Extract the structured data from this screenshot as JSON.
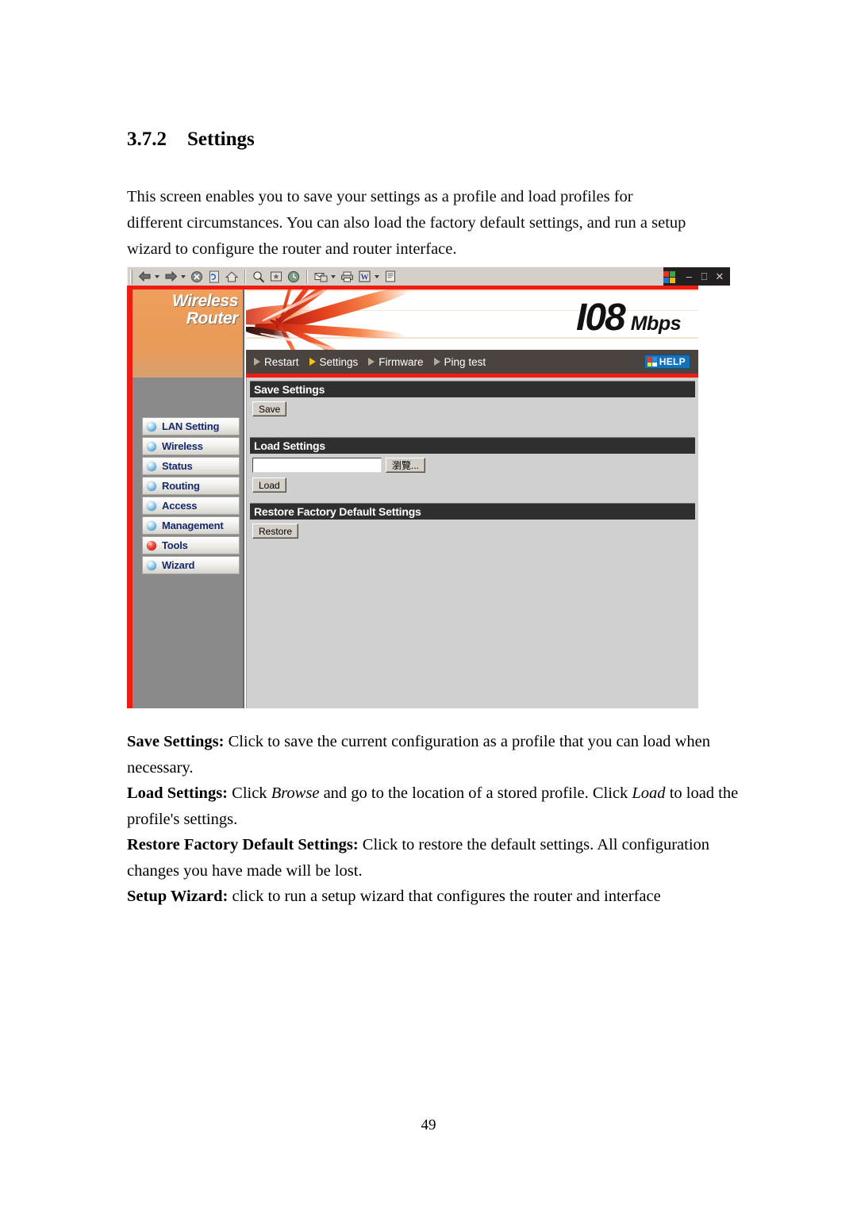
{
  "document": {
    "heading_number": "3.7.2",
    "heading_title": "Settings",
    "intro_line1": "This screen enables you to save your settings as a profile and load profiles for",
    "intro_line2": "different circumstances. You can also load the factory default settings, and run a setup",
    "intro_line3": "wizard to configure the router and router interface.",
    "page_number": "49"
  },
  "descriptions": [
    {
      "term": "Save Settings:",
      "text": " Click to save the current configuration as a profile that you can load when necessary."
    },
    {
      "term": "Load Settings:",
      "text_a": " Click ",
      "em_a": "Browse",
      "text_b": " and go to the location of a stored profile. Click ",
      "em_b": "Load",
      "text_c": " to load the profile's settings."
    },
    {
      "term": "Restore Factory Default Settings:",
      "text": " Click to restore the default settings. All configuration changes you have made will be lost."
    },
    {
      "term": "Setup Wizard:",
      "text": " click to run a setup wizard that configures the router and interface"
    }
  ],
  "browser": {
    "toolbar": {
      "icons": [
        "back-icon",
        "back-dropdown-icon",
        "forward-icon",
        "forward-dropdown-icon",
        "stop-icon",
        "refresh-icon",
        "home-icon",
        "search-icon",
        "favorites-icon",
        "history-icon",
        "mail-icon",
        "mail-dropdown-icon",
        "print-icon",
        "edit-icon",
        "edit-dropdown-icon",
        "discuss-icon"
      ]
    },
    "window_controls": {
      "minimize": "–",
      "restore": "❐",
      "close": "✕"
    }
  },
  "router_ui": {
    "logo_line1": "Wireless",
    "logo_line2": "Router",
    "banner_number": "I08",
    "banner_unit": "Mbps",
    "nav": [
      {
        "label": "Restart",
        "active": false
      },
      {
        "label": "Settings",
        "active": true
      },
      {
        "label": "Firmware",
        "active": false
      },
      {
        "label": "Ping test",
        "active": false
      }
    ],
    "help_label": "HELP",
    "sidebar": [
      {
        "label": "LAN Setting",
        "active": false
      },
      {
        "label": "Wireless",
        "active": false
      },
      {
        "label": "Status",
        "active": false
      },
      {
        "label": "Routing",
        "active": false
      },
      {
        "label": "Access",
        "active": false
      },
      {
        "label": "Management",
        "active": false
      },
      {
        "label": "Tools",
        "active": true
      },
      {
        "label": "Wizard",
        "active": false
      }
    ],
    "sections": {
      "save": {
        "header": "Save Settings",
        "button": "Save"
      },
      "load": {
        "header": "Load Settings",
        "file_value": "",
        "browse_button": "瀏覽...",
        "load_button": "Load"
      },
      "restore": {
        "header": "Restore Factory Default Settings",
        "button": "Restore"
      }
    }
  },
  "colors": {
    "accent_red": "#ee1c12",
    "nav_bar": "#4a4340",
    "section_header": "#2f2f2f",
    "menu_label": "#15296b",
    "help_blue": "#1472bb",
    "active_triangle": "#f2c41c"
  }
}
